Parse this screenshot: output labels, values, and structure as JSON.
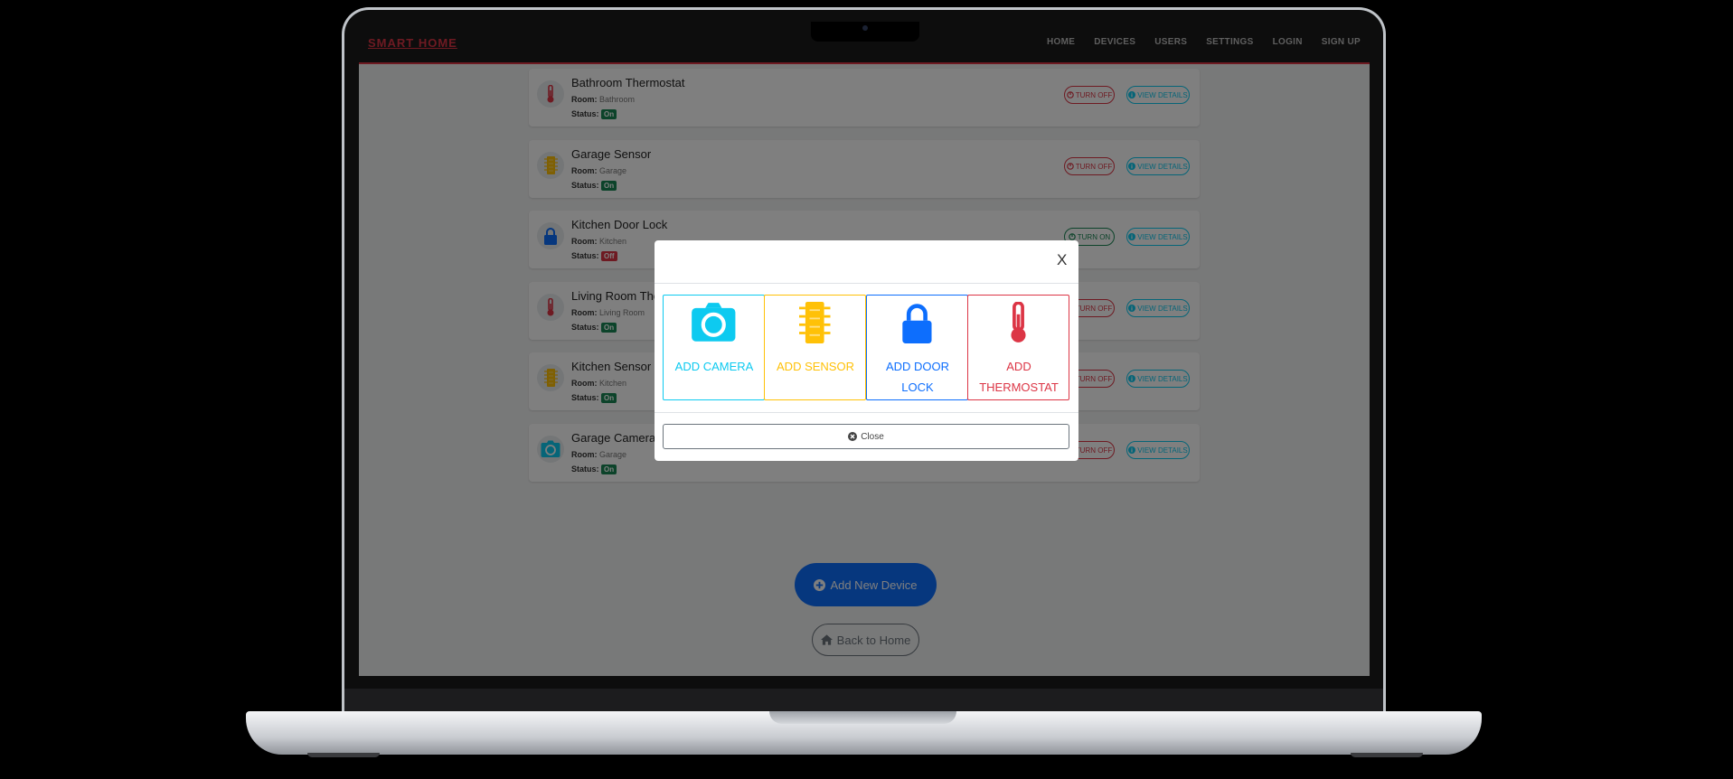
{
  "navbar": {
    "brand": "SMART HOME",
    "links": [
      "HOME",
      "DEVICES",
      "USERS",
      "SETTINGS",
      "LOGIN",
      "SIGN UP"
    ]
  },
  "labels": {
    "room": "Room:",
    "status": "Status:"
  },
  "devices": [
    {
      "name": "Bathroom Thermostat",
      "room": "Bathroom",
      "status": "On",
      "toggle": "TURN OFF",
      "view": "VIEW DETAILS",
      "icon": "thermometer-icon"
    },
    {
      "name": "Garage Sensor",
      "room": "Garage",
      "status": "On",
      "toggle": "TURN OFF",
      "view": "VIEW DETAILS",
      "icon": "chip-icon"
    },
    {
      "name": "Kitchen Door Lock",
      "room": "Kitchen",
      "status": "Off",
      "toggle": "TURN ON",
      "view": "VIEW DETAILS",
      "icon": "lock-icon"
    },
    {
      "name": "Living Room Thermostat",
      "room": "Living Room",
      "status": "On",
      "toggle": "TURN OFF",
      "view": "VIEW DETAILS",
      "icon": "thermometer-icon"
    },
    {
      "name": "Kitchen Sensor",
      "room": "Kitchen",
      "status": "On",
      "toggle": "TURN OFF",
      "view": "VIEW DETAILS",
      "icon": "chip-icon"
    },
    {
      "name": "Garage Camera",
      "room": "Garage",
      "status": "On",
      "toggle": "TURN OFF",
      "view": "VIEW DETAILS",
      "icon": "camera-icon"
    }
  ],
  "actions": {
    "add_device": "Add New Device",
    "back_home": "Back to Home"
  },
  "modal": {
    "close_x": "X",
    "options": [
      {
        "label": "ADD CAMERA",
        "color": "#0dcaf0",
        "icon": "camera-icon"
      },
      {
        "label": "ADD SENSOR",
        "color": "#ffc107",
        "icon": "chip-icon"
      },
      {
        "label": "ADD DOOR LOCK",
        "color": "#0d6efd",
        "icon": "lock-icon"
      },
      {
        "label": "ADD THERMOSTAT",
        "color": "#dc3545",
        "icon": "thermometer-icon"
      }
    ],
    "close_label": "Close"
  },
  "colors": {
    "brand": "#dc3545",
    "primary": "#0d6efd",
    "success": "#198754",
    "danger": "#dc3545",
    "info": "#0dcaf0",
    "warning": "#ffc107"
  }
}
